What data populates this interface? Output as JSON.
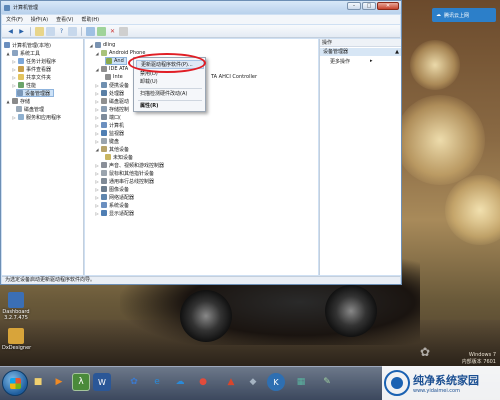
{
  "window": {
    "title": "计算机管理",
    "menu": [
      "文件(F)",
      "操作(A)",
      "查看(V)",
      "帮助(H)"
    ]
  },
  "top_pill": {
    "label": "腾讯云上网"
  },
  "left_tree": [
    {
      "label": "计算机管理(本地)",
      "level": 0
    },
    {
      "label": "系统工具",
      "level": 1
    },
    {
      "label": "任务计划程序",
      "level": 2
    },
    {
      "label": "事件查看器",
      "level": 2
    },
    {
      "label": "共享文件夹",
      "level": 2
    },
    {
      "label": "性能",
      "level": 2
    },
    {
      "label": "设备管理器",
      "level": 2,
      "selected": true
    },
    {
      "label": "存储",
      "level": 1
    },
    {
      "label": "磁盘管理",
      "level": 2
    },
    {
      "label": "服务和应用程序",
      "level": 1
    }
  ],
  "device_tree": [
    {
      "label": "dling",
      "level": 0
    },
    {
      "label": "Android Phone",
      "level": 1
    },
    {
      "label": "And",
      "level": 2,
      "selected": true
    },
    {
      "label": "IDE ATA",
      "level": 1
    },
    {
      "label": "Inte",
      "level": 2
    },
    {
      "label": "便携设备",
      "level": 1
    },
    {
      "label": "处理器",
      "level": 1
    },
    {
      "label": "磁盘驱动",
      "level": 1
    },
    {
      "label": "存储控制",
      "level": 1
    },
    {
      "label": "端口(",
      "level": 1
    },
    {
      "label": "计算机",
      "level": 1
    },
    {
      "label": "监视器",
      "level": 1
    },
    {
      "label": "键盘",
      "level": 1
    },
    {
      "label": "其他设备",
      "level": 1
    },
    {
      "label": "未知设备",
      "level": 2
    },
    {
      "label": "声音、视频和游戏控制器",
      "level": 1
    },
    {
      "label": "鼠标和其他指针设备",
      "level": 1
    },
    {
      "label": "通用串行总线控制器",
      "level": 1
    },
    {
      "label": "图像设备",
      "level": 1
    },
    {
      "label": "网络适配器",
      "level": 1
    },
    {
      "label": "系统设备",
      "level": 1
    },
    {
      "label": "显示适配器",
      "level": 1
    }
  ],
  "ide_suffix": "TA AHCI Controller",
  "context_menu": [
    {
      "label": "更新驱动程序软件(P)...",
      "highlighted": true
    },
    {
      "label": "禁用(D)"
    },
    {
      "label": "卸载(U)"
    },
    {
      "separator": true
    },
    {
      "label": "扫描检测硬件改动(A)"
    },
    {
      "separator": true
    },
    {
      "label": "属性(R)",
      "bold": true
    }
  ],
  "actions": {
    "header": "操作",
    "section": "设备管理器",
    "more": "更多操作"
  },
  "statusbar": "为选定设备启动更新驱动程序软件向导。",
  "desktop_icons": [
    {
      "label": "Dashboard 3.2.7.475",
      "color": "#3b6fb5"
    },
    {
      "label": "DxDesigner",
      "color": "#d8a43a"
    }
  ],
  "watermark": {
    "line1": "Windows 7",
    "line2": "内部版本 7601"
  },
  "brand": {
    "name": "纯净系统家园",
    "url": "www.yidaimei.com"
  },
  "taskbar_icons": [
    "folder-icon",
    "media-player-icon",
    "lambda-app-icon",
    "word-icon",
    "paw-app-icon",
    "ie-icon",
    "cloud-app-icon",
    "chrome-icon",
    "network-icon",
    "disk-icon",
    "k-app-icon",
    "calculator-icon",
    "feather-icon"
  ]
}
